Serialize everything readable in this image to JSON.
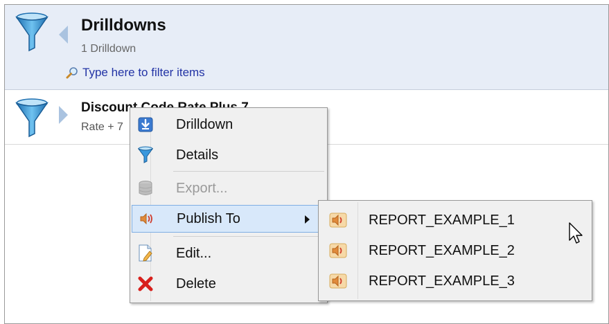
{
  "header": {
    "title": "Drilldowns",
    "subtitle": "1 Drilldown",
    "filter_placeholder": "Type here to filter items",
    "icon": "funnel-icon",
    "back_icon": "chevron-left-icon"
  },
  "list": {
    "items": [
      {
        "title": "Discount Code Rate Plus 7",
        "subtitle": "Rate + 7",
        "icon": "funnel-icon",
        "expand_icon": "chevron-right-icon"
      }
    ]
  },
  "context_menu": {
    "items": [
      {
        "label": "Drilldown",
        "icon": "download-arrow-icon",
        "enabled": true
      },
      {
        "label": "Details",
        "icon": "funnel-icon",
        "enabled": true
      },
      {
        "label": "Export...",
        "icon": "database-icon",
        "enabled": false
      },
      {
        "label": "Publish To",
        "icon": "speaker-icon",
        "enabled": true,
        "highlighted": true,
        "has_submenu": true
      },
      {
        "label": "Edit...",
        "icon": "edit-document-icon",
        "enabled": true
      },
      {
        "label": "Delete",
        "icon": "red-x-icon",
        "enabled": true
      }
    ]
  },
  "submenu": {
    "items": [
      {
        "label": "REPORT_EXAMPLE_1",
        "icon": "speaker-icon"
      },
      {
        "label": "REPORT_EXAMPLE_2",
        "icon": "speaker-icon"
      },
      {
        "label": "REPORT_EXAMPLE_3",
        "icon": "speaker-icon"
      }
    ]
  },
  "colors": {
    "header_bg": "#e7edf7",
    "link_text": "#2233a5",
    "menu_highlight": "#d8e8fa",
    "funnel_blue": "#2a8fd6"
  }
}
